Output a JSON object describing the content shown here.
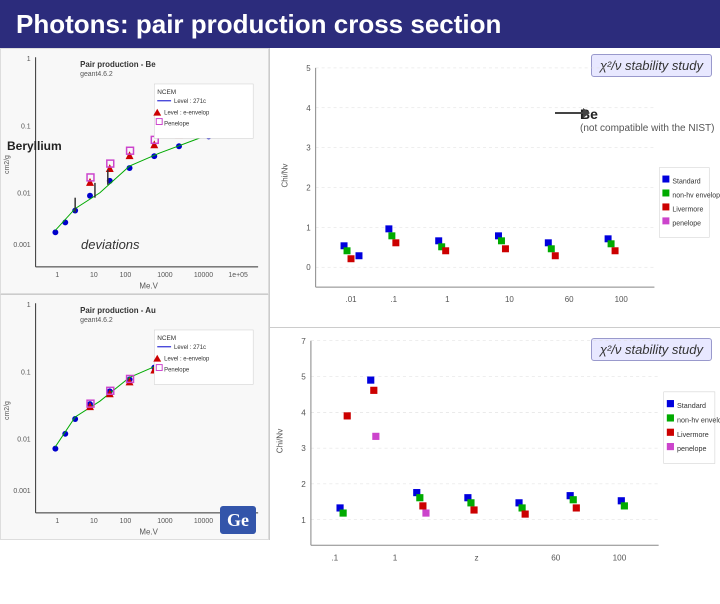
{
  "page": {
    "title": "Photons: pair production cross section",
    "stability_badge_1": "χ²/ν stability study",
    "stability_badge_2": "χ²/ν stability study",
    "label_beryllium": "Beryllium",
    "label_be": "Be",
    "label_nist": "(not compatible with the NIST)",
    "label_deviations": "deviations",
    "ge_label": "Ge",
    "plot1_title": "Pair production - Be",
    "plot1_x": "Me.V",
    "plot2_title": "Pair production - Au",
    "plot2_x": "Me.V",
    "legend": {
      "items": [
        {
          "label": "Standard",
          "color": "#0000cc"
        },
        {
          "label": "non-hv envelop",
          "color": "#00aa00"
        },
        {
          "label": "Livermore",
          "color": "#cc0000"
        },
        {
          "label": "penelope",
          "color": "#cc44cc"
        }
      ]
    }
  }
}
